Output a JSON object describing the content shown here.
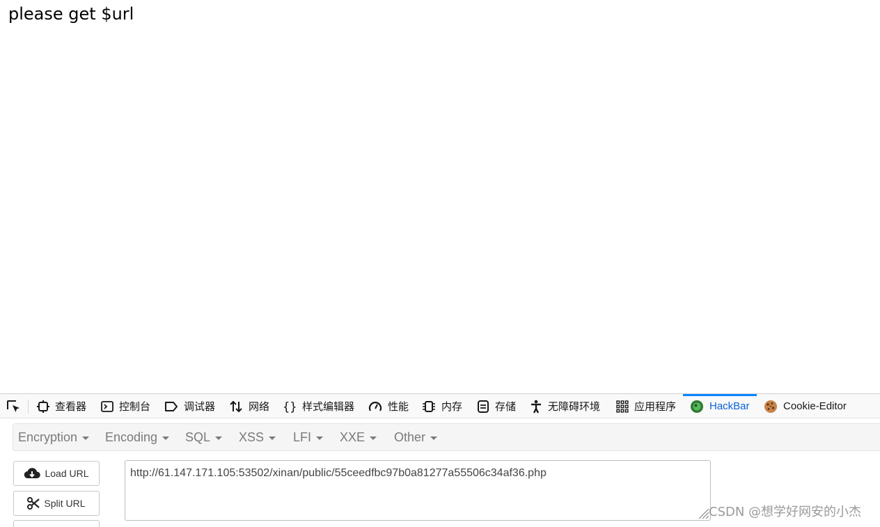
{
  "page": {
    "message": "please get $url"
  },
  "devtools": {
    "tabs": [
      {
        "label": "查看器",
        "icon": "inspector-icon"
      },
      {
        "label": "控制台",
        "icon": "console-icon"
      },
      {
        "label": "调试器",
        "icon": "debugger-icon"
      },
      {
        "label": "网络",
        "icon": "network-icon"
      },
      {
        "label": "样式编辑器",
        "icon": "style-editor-icon"
      },
      {
        "label": "性能",
        "icon": "performance-icon"
      },
      {
        "label": "内存",
        "icon": "memory-icon"
      },
      {
        "label": "存储",
        "icon": "storage-icon"
      },
      {
        "label": "无障碍环境",
        "icon": "accessibility-icon"
      },
      {
        "label": "应用程序",
        "icon": "application-icon"
      },
      {
        "label": "HackBar",
        "icon": "hackbar-icon",
        "active": true
      },
      {
        "label": "Cookie-Editor",
        "icon": "cookie-icon"
      }
    ],
    "active_color": "#0a84ff"
  },
  "hackbar": {
    "menus": [
      "Encryption",
      "Encoding",
      "SQL",
      "XSS",
      "LFI",
      "XXE",
      "Other"
    ],
    "load_url_label": "Load URL",
    "split_url_label": "Split URL",
    "url_value": "http://61.147.171.105:53502/xinan/public/55ceedfbc97b0a81277a55506c34af36.php"
  },
  "watermark": "CSDN @想学好网安的小杰"
}
